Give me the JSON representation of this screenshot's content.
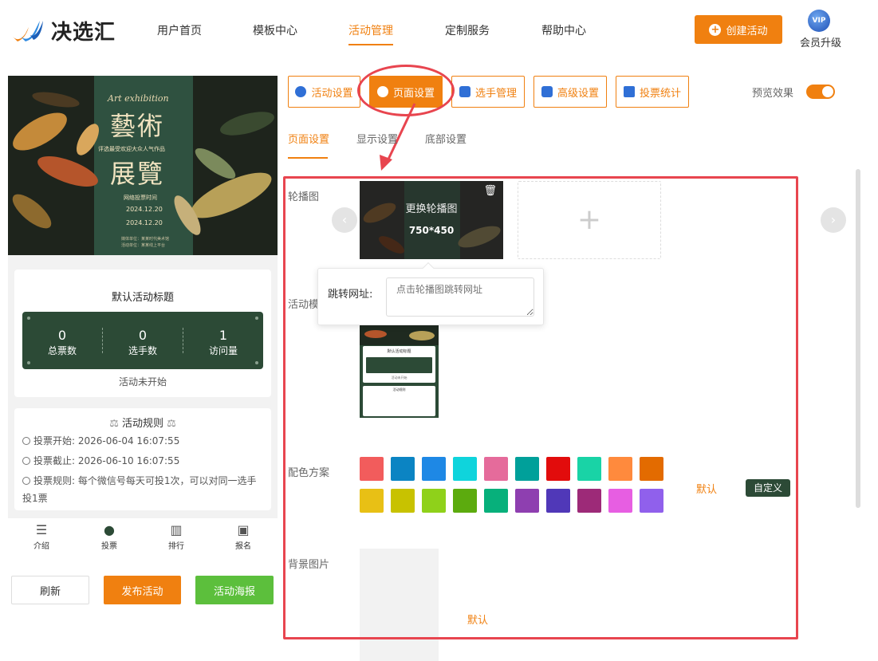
{
  "brand": {
    "name": "决选汇"
  },
  "nav": {
    "items": [
      "用户首页",
      "模板中心",
      "活动管理",
      "定制服务",
      "帮助中心"
    ],
    "active_index": 2
  },
  "header": {
    "create_label": "创建活动",
    "vip_badge": "VIP",
    "vip_label": "会员升级"
  },
  "poster": {
    "art_text": "Art exhibition",
    "title_top": "藝術",
    "subtitle": "评选最受欢迎大众人气作品",
    "title_bottom": "展覽",
    "vote_time_label": "网络投票时间",
    "date_start": "2024.12.20",
    "date_end": "2024.12.20",
    "footnote1": "媒体单位：某某时代美术馆",
    "footnote2": "活动单位：某某线上平台"
  },
  "activity": {
    "title": "默认活动标题",
    "stats": [
      {
        "value": "0",
        "label": "总票数"
      },
      {
        "value": "0",
        "label": "选手数"
      },
      {
        "value": "1",
        "label": "访问量"
      }
    ],
    "status": "活动未开始"
  },
  "rules": {
    "heading": "活动规则",
    "start_label": "投票开始:",
    "start_value": "2026-06-04 16:07:55",
    "end_label": "投票截止:",
    "end_value": "2026-06-10 16:07:55",
    "rule_label": "投票规则:",
    "rule_text": "每个微信号每天可投1次，可以对同一选手投1票"
  },
  "bottom_nav": [
    {
      "label": "介绍",
      "icon": "intro-icon"
    },
    {
      "label": "投票",
      "icon": "vote-icon"
    },
    {
      "label": "排行",
      "icon": "ranking-icon"
    },
    {
      "label": "报名",
      "icon": "signup-icon"
    }
  ],
  "actions": {
    "refresh": "刷新",
    "publish": "发布活动",
    "poster": "活动海报"
  },
  "toolbar": {
    "items": [
      "活动设置",
      "页面设置",
      "选手管理",
      "高级设置",
      "投票统计"
    ],
    "active_index": 1,
    "preview_label": "预览效果",
    "preview_on": true
  },
  "subtabs": {
    "items": [
      "页面设置",
      "显示设置",
      "底部设置"
    ],
    "active_index": 0
  },
  "settings": {
    "carousel_label": "轮播图",
    "carousel_change": "更换轮播图",
    "carousel_size": "750*450",
    "jump_label": "跳转网址:",
    "jump_placeholder": "点击轮播图跳转网址",
    "template_label": "活动模",
    "color_label": "配色方案",
    "color_default": "默认",
    "color_custom": "自定义",
    "bg_label": "背景图片",
    "bg_default": "默认",
    "colors": [
      "#f25c5c",
      "#0b84c3",
      "#1e88e5",
      "#0fd4dc",
      "#e56b9b",
      "#00a09a",
      "#e20c0c",
      "#19d3a6",
      "#ff8a3d",
      "#e36b00",
      "#e8c015",
      "#c8c200",
      "#8fd11a",
      "#5cab0e",
      "#07b07b",
      "#8e3fb0",
      "#5038b8",
      "#9d2a78",
      "#e75ee2",
      "#9060ec"
    ]
  },
  "mini_preview": {
    "title": "默认活动标题",
    "status": "活动未开始",
    "rules": "活动规则"
  },
  "colors": {
    "accent": "#f08010",
    "theme": "#2c4a36",
    "highlight": "#e8454f"
  }
}
